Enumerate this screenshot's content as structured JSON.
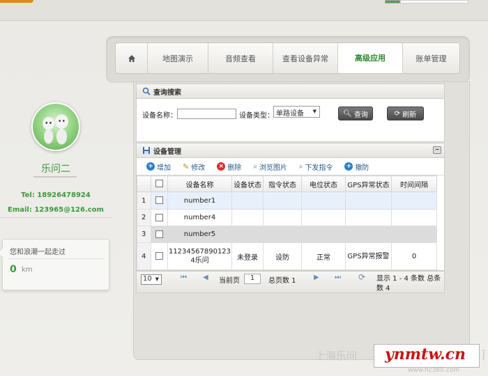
{
  "nav": {
    "home_icon": "home-icon",
    "tabs": [
      {
        "label": "地图演示",
        "width": 80
      },
      {
        "label": "音频查看",
        "width": 93
      },
      {
        "label": "查看设备异常",
        "width": 93
      },
      {
        "label": "高级应用",
        "width": 93
      },
      {
        "label": "账单管理",
        "width": 83
      }
    ],
    "active_tab": "高级应用",
    "active_color": "#2e8b2e"
  },
  "profile": {
    "name": "乐问二",
    "tel": "Tel: 18926478924",
    "email": "Email: 123965@126.com",
    "distance_text": "您和浪潮一起走过",
    "distance_value": "0",
    "distance_unit": "km",
    "accent": "#3b9a3b"
  },
  "search": {
    "title": "查询搜索",
    "device_name_label": "设备名称：",
    "device_name_value": "",
    "device_type_label": "设备类型：",
    "device_type_value": "单路设备",
    "search_button": "查询",
    "refresh_button": "刷新"
  },
  "manager": {
    "title": "设备管理",
    "toolbar": [
      {
        "label": "增加",
        "icon": "add-icon"
      },
      {
        "label": "修改",
        "icon": "edit-icon"
      },
      {
        "label": "删除",
        "icon": "delete-icon"
      },
      {
        "label": "浏览图片",
        "icon": "browse-images-icon"
      },
      {
        "label": "下发指令",
        "icon": "send-command-icon"
      },
      {
        "label": "撤防",
        "icon": "disarm-icon"
      }
    ],
    "columns": [
      "设备名称",
      "设备状态",
      "指令状态",
      "电位状态",
      "GPS异常状态",
      "时间间隔"
    ],
    "rows": [
      {
        "n": "1",
        "name": "number1",
        "status": "",
        "cmd": "",
        "power": "",
        "gps": "",
        "interval": ""
      },
      {
        "n": "2",
        "name": "number4",
        "status": "",
        "cmd": "",
        "power": "",
        "gps": "",
        "interval": ""
      },
      {
        "n": "3",
        "name": "number5",
        "status": "",
        "cmd": "",
        "power": "",
        "gps": "",
        "interval": ""
      },
      {
        "n": "4",
        "name": "112345678901234乐问",
        "status": "未登录",
        "cmd": "设防",
        "power": "正常",
        "gps": "GPS异常报警",
        "interval": "0"
      }
    ]
  },
  "pager": {
    "page_size": "10",
    "current_label": "当前页",
    "current_page": "1",
    "total_pages": "总页数 1",
    "summary": "显示 1 - 4 条数 总条数 4"
  },
  "watermark": {
    "cn_text": "上海乐问",
    "site": "ynmtw.cn",
    "small": "www.hc360.com"
  }
}
